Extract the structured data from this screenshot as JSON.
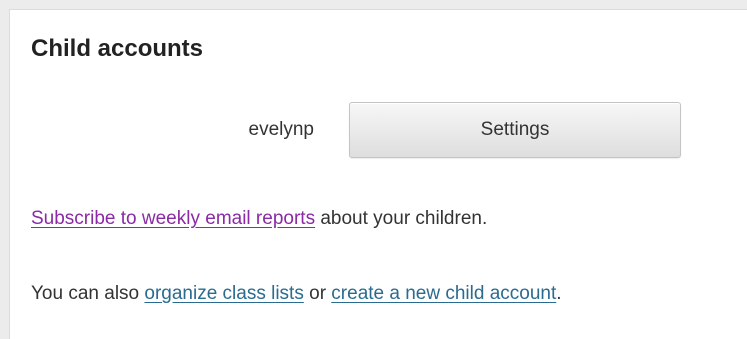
{
  "panel": {
    "title": "Child accounts"
  },
  "accounts": [
    {
      "username": "evelynp",
      "settings_label": "Settings"
    }
  ],
  "subscribe": {
    "link_text": "Subscribe to weekly email reports",
    "suffix": " about your children."
  },
  "also": {
    "prefix": "You can also ",
    "organize_link": "organize class lists",
    "middle": " or ",
    "create_link": "create a new child account",
    "suffix": "."
  },
  "colors": {
    "visited_link": "#8b2aa6",
    "link": "#2a6b8f",
    "text": "#333333",
    "title": "#222222"
  }
}
